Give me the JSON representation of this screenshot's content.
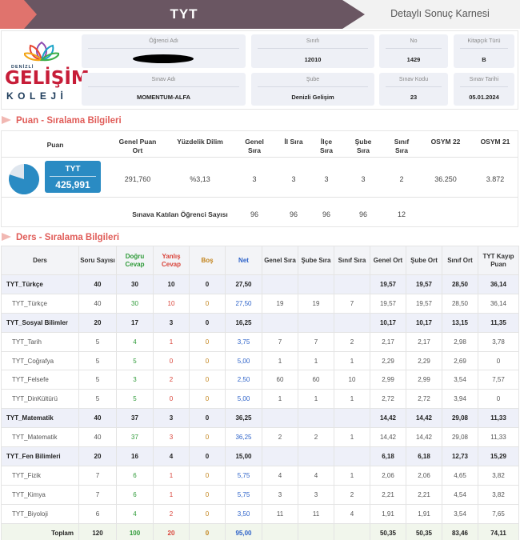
{
  "header": {
    "title": "TYT",
    "subtitle": "Detaylı Sonuç Karnesi"
  },
  "logo": {
    "top_text": "DENİZLİ",
    "main_text": "GELİŞİM",
    "sub_text": "KOLEJİ"
  },
  "student": {
    "name_label": "Öğrenci Adı",
    "name_value": "",
    "class_label": "Sınıfı",
    "class_value": "12010",
    "no_label": "No",
    "no_value": "1429",
    "booklet_label": "Kitapçık Türü",
    "booklet_value": "B",
    "exam_label": "Sınav Adı",
    "exam_value": "MOMENTUM-ALFA",
    "branch_label": "Şube",
    "branch_value": "Denizli Gelişim",
    "exam_code_label": "Sınav Kodu",
    "exam_code_value": "23",
    "date_label": "Sınav Tarihi",
    "date_value": "05.01.2024"
  },
  "score_section": {
    "title": "Puan - Sıralama Bilgileri",
    "headers": {
      "puan": "Puan",
      "genel_puan_ort": "Genel Puan Ort",
      "yuzdelik": "Yüzdelik Dilim",
      "genel_sira": "Genel Sıra",
      "il_sira": "İl Sıra",
      "ilce_sira": "İlçe Sıra",
      "sube_sira": "Şube Sıra",
      "sinif_sira": "Sınıf Sıra",
      "osym22": "OSYM 22",
      "osym21": "OSYM 21"
    },
    "score_name": "TYT",
    "score_value": "425,991",
    "pie_fraction": 0.8,
    "values": {
      "genel_puan_ort": "291,760",
      "yuzdelik": "%3,13",
      "genel_sira": "3",
      "il_sira": "3",
      "ilce_sira": "3",
      "sube_sira": "3",
      "sinif_sira": "2",
      "osym22": "36.250",
      "osym21": "3.872"
    },
    "participants_label": "Sınava Katılan Öğrenci Sayısı",
    "participants": {
      "genel": "96",
      "il": "96",
      "ilce": "96",
      "sube": "96",
      "sinif": "12"
    }
  },
  "lesson_section": {
    "title": "Ders - Sıralama Bilgileri",
    "headers": [
      "Ders",
      "Soru Sayısı",
      "Doğru Cevap",
      "Yanlış Cevap",
      "Boş",
      "Net",
      "Genel Sıra",
      "Şube Sıra",
      "Sınıf Sıra",
      "Genel Ort",
      "Şube Ort",
      "Sınıf Ort",
      "TYT Kayıp Puan"
    ],
    "rows": [
      {
        "main": true,
        "name": "TYT_Türkçe",
        "cells": [
          "40",
          "30",
          "10",
          "0",
          "27,50",
          "",
          "",
          "",
          "19,57",
          "19,57",
          "28,50",
          "36,14"
        ]
      },
      {
        "main": false,
        "name": "TYT_Türkçe",
        "cells": [
          "40",
          "30",
          "10",
          "0",
          "27,50",
          "19",
          "19",
          "7",
          "19,57",
          "19,57",
          "28,50",
          "36,14"
        ]
      },
      {
        "main": true,
        "name": "TYT_Sosyal Bilimler",
        "cells": [
          "20",
          "17",
          "3",
          "0",
          "16,25",
          "",
          "",
          "",
          "10,17",
          "10,17",
          "13,15",
          "11,35"
        ]
      },
      {
        "main": false,
        "name": "TYT_Tarih",
        "cells": [
          "5",
          "4",
          "1",
          "0",
          "3,75",
          "7",
          "7",
          "2",
          "2,17",
          "2,17",
          "2,98",
          "3,78"
        ]
      },
      {
        "main": false,
        "name": "TYT_Coğrafya",
        "cells": [
          "5",
          "5",
          "0",
          "0",
          "5,00",
          "1",
          "1",
          "1",
          "2,29",
          "2,29",
          "2,69",
          "0"
        ]
      },
      {
        "main": false,
        "name": "TYT_Felsefe",
        "cells": [
          "5",
          "3",
          "2",
          "0",
          "2,50",
          "60",
          "60",
          "10",
          "2,99",
          "2,99",
          "3,54",
          "7,57"
        ]
      },
      {
        "main": false,
        "name": "TYT_DinKültürü",
        "cells": [
          "5",
          "5",
          "0",
          "0",
          "5,00",
          "1",
          "1",
          "1",
          "2,72",
          "2,72",
          "3,94",
          "0"
        ]
      },
      {
        "main": true,
        "name": "TYT_Matematik",
        "cells": [
          "40",
          "37",
          "3",
          "0",
          "36,25",
          "",
          "",
          "",
          "14,42",
          "14,42",
          "29,08",
          "11,33"
        ]
      },
      {
        "main": false,
        "name": "TYT_Matematik",
        "cells": [
          "40",
          "37",
          "3",
          "0",
          "36,25",
          "2",
          "2",
          "1",
          "14,42",
          "14,42",
          "29,08",
          "11,33"
        ]
      },
      {
        "main": true,
        "name": "TYT_Fen Bilimleri",
        "cells": [
          "20",
          "16",
          "4",
          "0",
          "15,00",
          "",
          "",
          "",
          "6,18",
          "6,18",
          "12,73",
          "15,29"
        ]
      },
      {
        "main": false,
        "name": "TYT_Fizik",
        "cells": [
          "7",
          "6",
          "1",
          "0",
          "5,75",
          "4",
          "4",
          "1",
          "2,06",
          "2,06",
          "4,65",
          "3,82"
        ]
      },
      {
        "main": false,
        "name": "TYT_Kimya",
        "cells": [
          "7",
          "6",
          "1",
          "0",
          "5,75",
          "3",
          "3",
          "2",
          "2,21",
          "2,21",
          "4,54",
          "3,82"
        ]
      },
      {
        "main": false,
        "name": "TYT_Biyoloji",
        "cells": [
          "6",
          "4",
          "2",
          "0",
          "3,50",
          "11",
          "11",
          "4",
          "1,91",
          "1,91",
          "3,54",
          "7,65"
        ]
      }
    ],
    "total": {
      "name": "Toplam",
      "cells": [
        "120",
        "100",
        "20",
        "0",
        "95,00",
        "",
        "",
        "",
        "50,35",
        "50,35",
        "83,46",
        "74,11"
      ]
    }
  },
  "colors": {
    "banner": "#6a5662",
    "banner_accent": "#e0736d",
    "score_box": "#2a8bc3",
    "correct": "#2e9a38",
    "wrong": "#d9443a",
    "empty": "#c2831a",
    "net": "#2e63c9"
  }
}
